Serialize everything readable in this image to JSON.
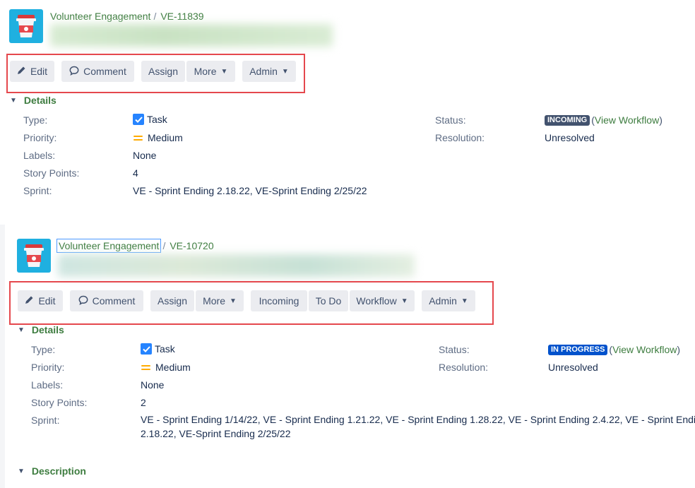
{
  "issues": [
    {
      "project": "Volunteer Engagement",
      "key": "VE-11839",
      "toolbar": {
        "edit": "Edit",
        "comment": "Comment",
        "assign": "Assign",
        "more": "More",
        "admin": "Admin"
      },
      "details_title": "Details",
      "fields": {
        "type_label": "Type:",
        "type_value": "Task",
        "priority_label": "Priority:",
        "priority_value": "Medium",
        "labels_label": "Labels:",
        "labels_value": "None",
        "story_points_label": "Story Points:",
        "story_points_value": "4",
        "sprint_label": "Sprint:",
        "sprint_value": "VE - Sprint Ending 2.18.22, VE-Sprint Ending 2/25/22",
        "status_label": "Status:",
        "status_value": "INCOMING",
        "status_color": "#42526e",
        "view_workflow": "View Workflow",
        "resolution_label": "Resolution:",
        "resolution_value": "Unresolved"
      }
    },
    {
      "project": "Volunteer Engagement",
      "key": "VE-10720",
      "toolbar": {
        "edit": "Edit",
        "comment": "Comment",
        "assign": "Assign",
        "more": "More",
        "incoming": "Incoming",
        "todo": "To Do",
        "workflow": "Workflow",
        "admin": "Admin"
      },
      "details_title": "Details",
      "fields": {
        "type_label": "Type:",
        "type_value": "Task",
        "priority_label": "Priority:",
        "priority_value": "Medium",
        "labels_label": "Labels:",
        "labels_value": "None",
        "story_points_label": "Story Points:",
        "story_points_value": "2",
        "sprint_label": "Sprint:",
        "sprint_value_line1": "VE - Sprint Ending 1/14/22, VE - Sprint Ending 1.21.22, VE - Sprint Ending 1.28.22, VE - Sprint Ending 2.4.22, VE - Sprint Ending",
        "sprint_value_line2": "2.18.22, VE-Sprint Ending 2/25/22",
        "status_label": "Status:",
        "status_value": "IN PROGRESS",
        "status_color": "#0052cc",
        "view_workflow": "View Workflow",
        "resolution_label": "Resolution:",
        "resolution_value": "Unresolved"
      },
      "description_title": "Description"
    }
  ],
  "colors": {
    "link_green": "#3d7c3f",
    "highlight_red": "#e5484d",
    "avatar_blue": "#1fb0e0",
    "button_bg": "#ebecf0"
  },
  "icons": {
    "project_avatar": "coffee-cup-icon",
    "edit": "pencil-icon",
    "comment": "speech-bubble-icon",
    "dropdown": "chevron-down-icon",
    "type": "checkbox-icon",
    "priority": "medium-priority-icon",
    "toggle": "collapse-toggle-icon"
  }
}
